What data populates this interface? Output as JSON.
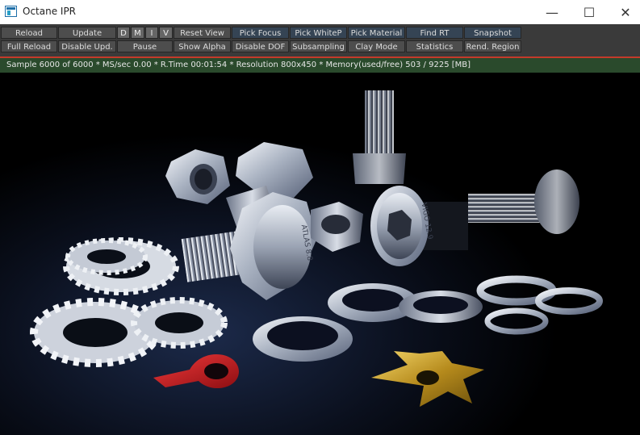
{
  "window": {
    "title": "Octane IPR",
    "minimize_glyph": "—",
    "maximize_glyph": "☐",
    "close_glyph": "✕"
  },
  "toolbar": {
    "row1": {
      "reload": "Reload",
      "update": "Update",
      "pass_d": "D",
      "pass_m": "M",
      "pass_i": "I",
      "pass_v": "V",
      "reset_view": "Reset View",
      "pick_focus": "Pick Focus",
      "pick_white": "Pick WhiteP",
      "pick_material": "Pick Material",
      "find_rt": "Find RT",
      "snapshot": "Snapshot"
    },
    "row2": {
      "full_reload": "Full Reload",
      "disable_upd": "Disable Upd.",
      "pause": "Pause",
      "show_alpha": "Show Alpha",
      "disable_dof": "Disable DOF",
      "subsampling": "Subsampling",
      "clay_mode": "Clay Mode",
      "statistics": "Statistics",
      "rend_region": "Rend. Region"
    }
  },
  "status": {
    "text": "Sample 6000 of 6000 * MS/sec 0.00 * R.Time 00:01:54 * Resolution 800x450 * Memory(used/free) 503 / 9225 [MB]"
  },
  "render": {
    "bolt_head_text_1": "ATLAS 8.8",
    "bolt_head_text_2": "VIGO 12.9"
  },
  "colors": {
    "status_bar": "#2a4a2c",
    "accent_line": "#c43a2b",
    "button_blue": "#354454"
  }
}
